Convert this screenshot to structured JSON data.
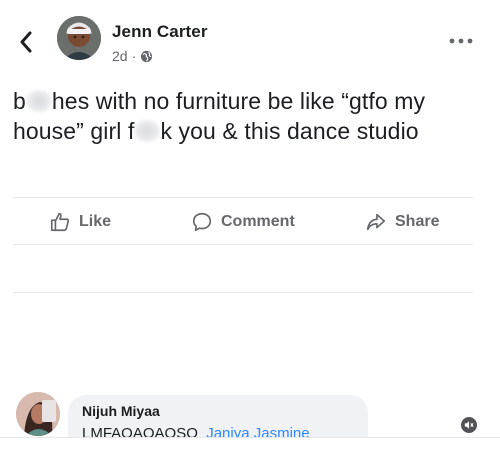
{
  "post": {
    "author": "Jenn Carter",
    "time": "2d",
    "separator": "·",
    "audience_icon": "globe-icon",
    "text_part1": "b",
    "text_part2": "hes with no furniture be like “gtfo my house” girl f",
    "text_part3": "k you & this dance studio"
  },
  "actions": {
    "like_label": "Like",
    "comment_label": "Comment",
    "share_label": "Share"
  },
  "comment": {
    "author": "Nijuh Miyaa",
    "text": "LMFAOAOAOSO",
    "mentions": "Janiya Jasmine"
  },
  "icons": {
    "back": "chevron-left-icon",
    "more": "more-dots-icon",
    "like": "thumbs-up-icon",
    "comment": "speech-bubble-icon",
    "share": "share-arrow-icon",
    "mute": "muted-speaker-icon"
  },
  "colors": {
    "text": "#1c1e21",
    "muted": "#65676b",
    "mention": "#2d88ff",
    "bubble": "#f0f2f5",
    "divider": "#e4e6e9"
  }
}
